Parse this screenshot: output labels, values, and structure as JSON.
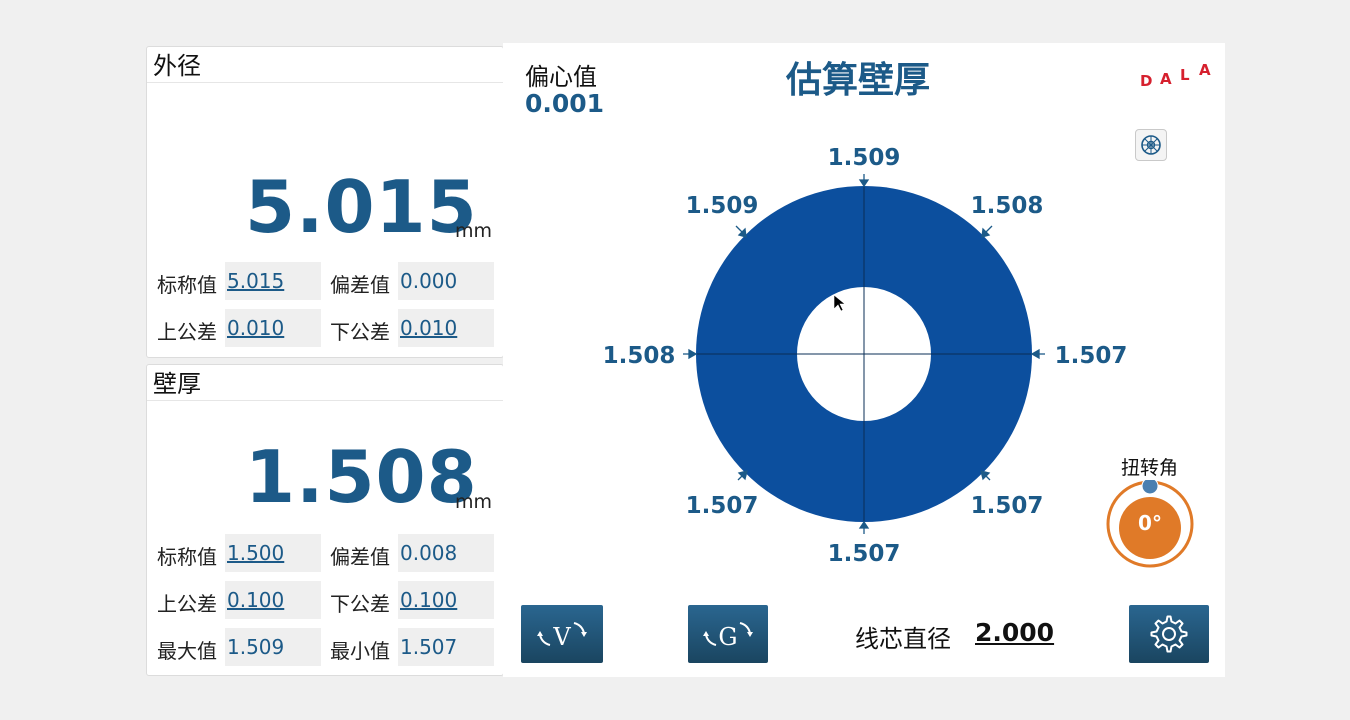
{
  "od_panel": {
    "title": "外径",
    "value": "5.015",
    "unit": "mm",
    "fields": [
      {
        "label": "标称值",
        "value": "5.015"
      },
      {
        "label": "偏差值",
        "value": "0.000"
      },
      {
        "label": "上公差",
        "value": "0.010"
      },
      {
        "label": "下公差",
        "value": "0.010"
      }
    ]
  },
  "wall_panel": {
    "title": "壁厚",
    "value": "1.508",
    "unit": "mm",
    "fields": [
      {
        "label": "标称值",
        "value": "1.500"
      },
      {
        "label": "偏差值",
        "value": "0.008"
      },
      {
        "label": "上公差",
        "value": "0.100"
      },
      {
        "label": "下公差",
        "value": "0.100"
      },
      {
        "label": "最大值",
        "value": "1.509"
      },
      {
        "label": "最小值",
        "value": "1.507"
      }
    ]
  },
  "main": {
    "eccentricity_label": "偏心值",
    "eccentricity_value": "0.001",
    "title": "估算壁厚",
    "logo_text": "DALA",
    "logo_color": "#d6202e",
    "ring_color": "#0c4f9e",
    "accent_color": "#1c5a88",
    "measurements": {
      "top": "1.509",
      "top_right": "1.508",
      "right": "1.507",
      "bottom_right": "1.507",
      "bottom": "1.507",
      "bottom_left": "1.507",
      "left": "1.508",
      "top_left": "1.509"
    },
    "twist_label": "扭转角",
    "twist_value": "0°",
    "twist_color": "#e07a28",
    "core_label": "线芯直径",
    "core_value": "2.000",
    "icons": {
      "small_button": "cross-section-icon",
      "v_button": "rotate-v-icon",
      "g_button": "rotate-g-icon",
      "settings_button": "gear-icon"
    }
  }
}
